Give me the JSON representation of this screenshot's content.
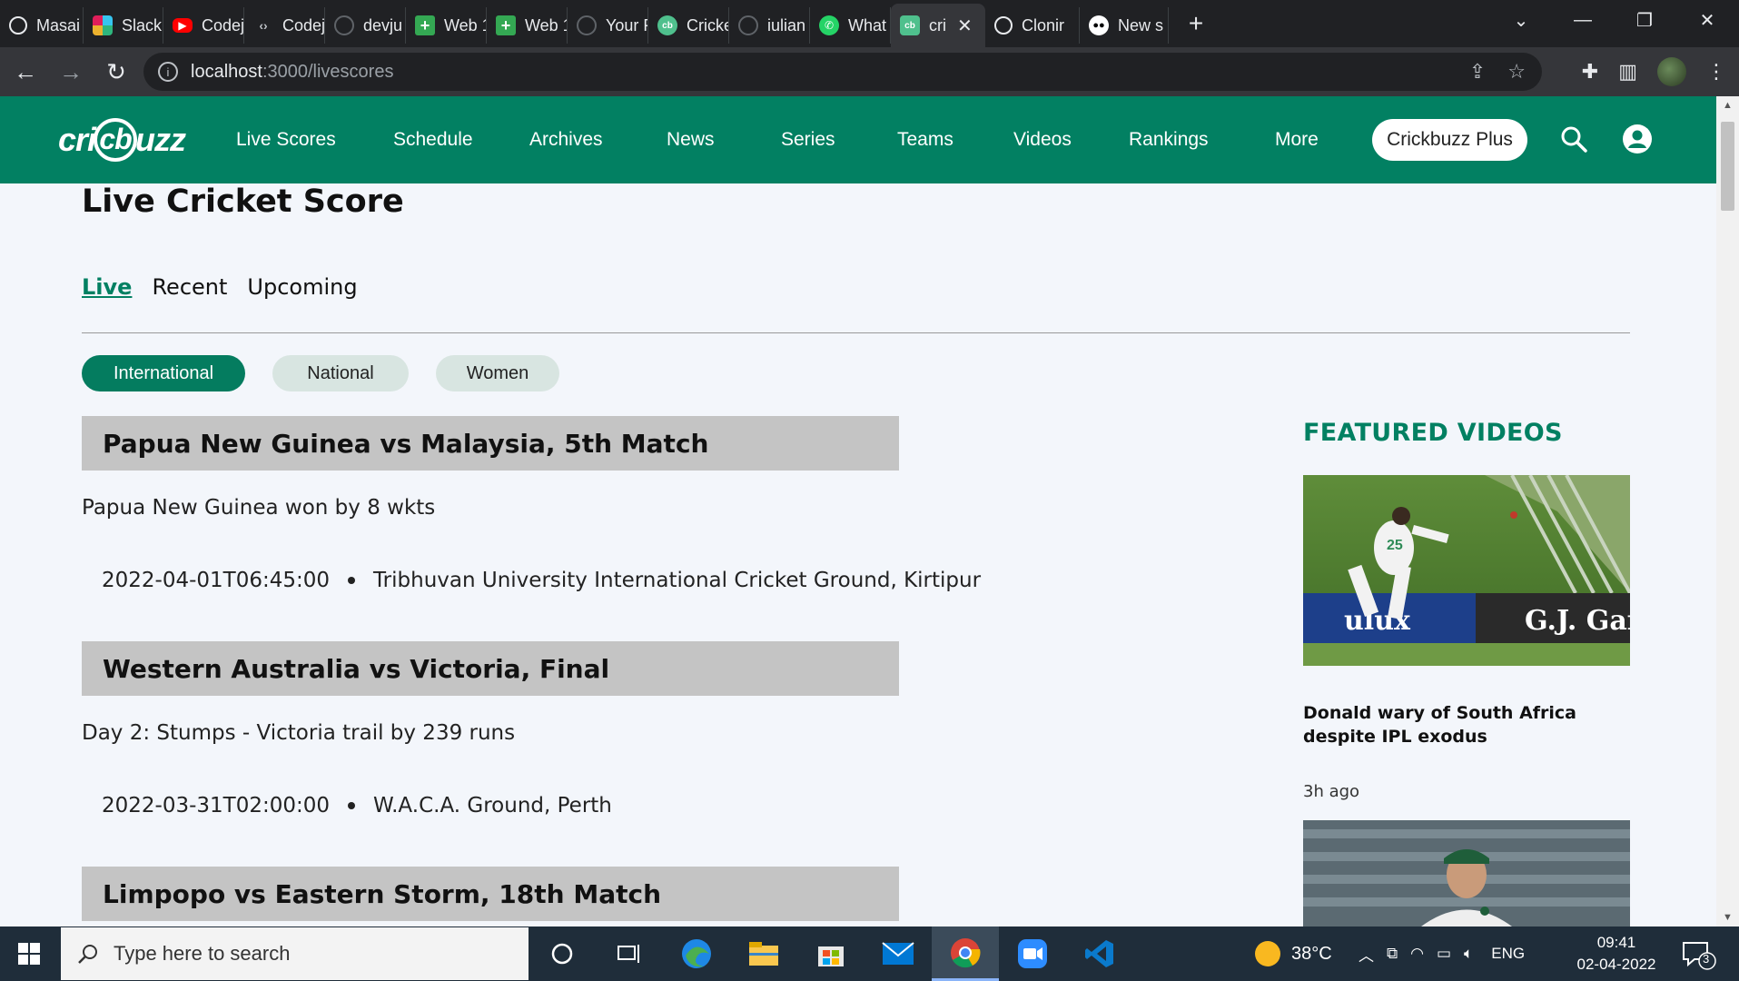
{
  "browser": {
    "tabs": [
      {
        "label": "Masai",
        "icon": "globe-icon",
        "color": "#e8eaed"
      },
      {
        "label": "Slack |",
        "icon": "slack-icon",
        "color": "#e01e5a"
      },
      {
        "label": "Codej",
        "icon": "youtube-icon",
        "color": "#ff0000"
      },
      {
        "label": "Codej",
        "icon": "codej-icon",
        "color": "#9aa0a6"
      },
      {
        "label": "devju",
        "icon": "github-icon",
        "color": "#e8eaed"
      },
      {
        "label": "Web 1",
        "icon": "plus-doc-icon",
        "color": "#34a853"
      },
      {
        "label": "Web 1",
        "icon": "plus-doc-icon",
        "color": "#34a853"
      },
      {
        "label": "Your F",
        "icon": "github-icon",
        "color": "#e8eaed"
      },
      {
        "label": "Cricke",
        "icon": "cricbuzz-icon",
        "color": "#4fc08d"
      },
      {
        "label": "iulian",
        "icon": "github-icon",
        "color": "#e8eaed"
      },
      {
        "label": "What",
        "icon": "whatsapp-icon",
        "color": "#25d366"
      },
      {
        "label": "cri",
        "icon": "cricbuzz-icon",
        "color": "#4fc08d",
        "active": true
      },
      {
        "label": "Clonir",
        "icon": "globe-icon",
        "color": "#e8eaed"
      },
      {
        "label": "New s",
        "icon": "medium-icon",
        "color": "#ffffff"
      }
    ],
    "url_host": "localhost",
    "url_path": ":3000/livescores"
  },
  "header": {
    "logo_text_left": "cri",
    "logo_text_circle": "cb",
    "logo_text_right": "uzz",
    "nav": [
      "Live Scores",
      "Schedule",
      "Archives",
      "News",
      "Series",
      "Teams",
      "Videos",
      "Rankings",
      "More"
    ],
    "plus_button": "Crickbuzz Plus"
  },
  "page": {
    "title": "Live Cricket Score",
    "subtabs": [
      "Live",
      "Recent",
      "Upcoming"
    ],
    "filters": [
      "International",
      "National",
      "Women"
    ]
  },
  "matches": [
    {
      "title": "Papua New Guinea vs Malaysia, 5th Match",
      "status": "Papua New Guinea won by 8 wkts",
      "datetime": "2022-04-01T06:45:00",
      "venue": "Tribhuvan University International Cricket Ground, Kirtipur"
    },
    {
      "title": "Western Australia vs Victoria, Final",
      "status": "Day 2: Stumps - Victoria trail by 239 runs",
      "datetime": "2022-03-31T02:00:00",
      "venue": "W.A.C.A. Ground, Perth"
    },
    {
      "title": "Limpopo vs Eastern Storm, 18th Match"
    }
  ],
  "featured": {
    "heading": "FEATURED VIDEOS",
    "videos": [
      {
        "caption": "Donald wary of South Africa despite IPL exodus",
        "time": "3h ago",
        "board_text": "G.J. Gar",
        "board_text2": "ulux"
      }
    ]
  },
  "taskbar": {
    "search_placeholder": "Type here to search",
    "weather": "38°C",
    "language": "ENG",
    "time": "09:41",
    "date": "02-04-2022",
    "notifications": "3"
  },
  "colors": {
    "brand": "#028062",
    "active_pill": "#047c5f",
    "match_header": "#c4c4c4"
  }
}
